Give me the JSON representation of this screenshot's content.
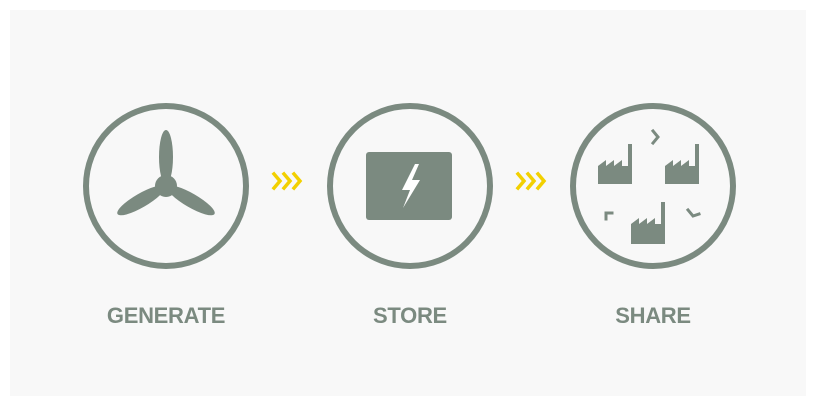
{
  "colors": {
    "icon": "#7b8a80",
    "accent": "#f2d000",
    "background": "#f8f8f8"
  },
  "steps": [
    {
      "label": "GENERATE",
      "icon": "wind-turbine-icon"
    },
    {
      "label": "STORE",
      "icon": "battery-lightning-icon"
    },
    {
      "label": "SHARE",
      "icon": "factories-network-icon"
    }
  ],
  "connectors": [
    {
      "icon": "triple-chevron-right-icon"
    },
    {
      "icon": "triple-chevron-right-icon"
    }
  ]
}
